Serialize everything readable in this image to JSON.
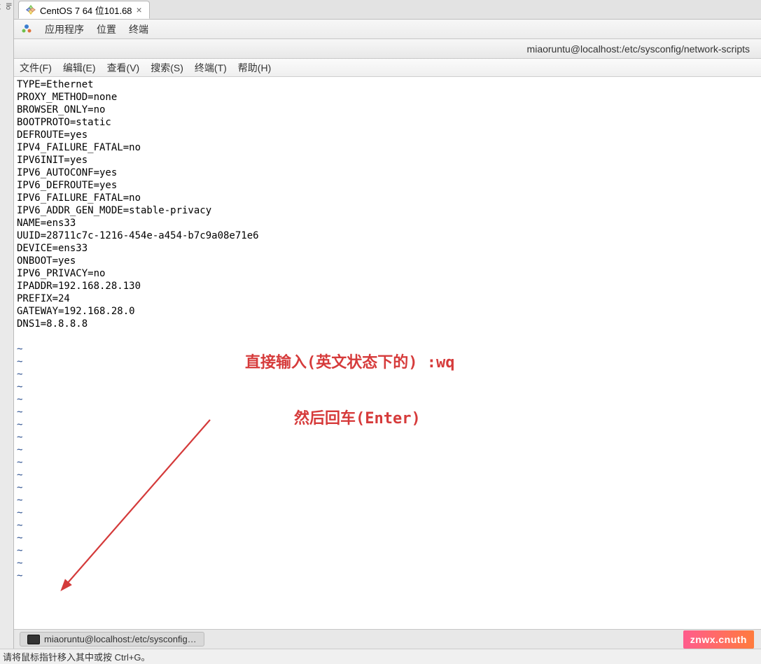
{
  "tab": {
    "title": "CentOS 7 64 位101.68",
    "close": "×"
  },
  "gnome": {
    "apps": "应用程序",
    "places": "位置",
    "terminal": "终端"
  },
  "term_title": "miaoruntu@localhost:/etc/sysconfig/network-scripts",
  "term_menu": {
    "file": "文件(F)",
    "edit": "编辑(E)",
    "view": "查看(V)",
    "search": "搜索(S)",
    "terminal": "终端(T)",
    "help": "帮助(H)"
  },
  "file_lines": [
    "TYPE=Ethernet",
    "PROXY_METHOD=none",
    "BROWSER_ONLY=no",
    "BOOTPROTO=static",
    "DEFROUTE=yes",
    "IPV4_FAILURE_FATAL=no",
    "IPV6INIT=yes",
    "IPV6_AUTOCONF=yes",
    "IPV6_DEFROUTE=yes",
    "IPV6_FAILURE_FATAL=no",
    "IPV6_ADDR_GEN_MODE=stable-privacy",
    "NAME=ens33",
    "UUID=28711c7c-1216-454e-a454-b7c9a08e71e6",
    "DEVICE=ens33",
    "ONBOOT=yes",
    "IPV6_PRIVACY=no",
    "IPADDR=192.168.28.130",
    "PREFIX=24",
    "GATEWAY=192.168.28.0",
    "DNS1=8.8.8.8"
  ],
  "tilde_count": 19,
  "vi_command": ": wq",
  "annotations": {
    "line1": "直接输入(英文状态下的) :wq",
    "line2": "然后回车(Enter)"
  },
  "taskbar_item": "miaoruntu@localhost:/etc/sysconfig…",
  "vm_hint": "请将鼠标指针移入其中或按 Ctrl+G。",
  "watermark": "znwx.cnuth"
}
